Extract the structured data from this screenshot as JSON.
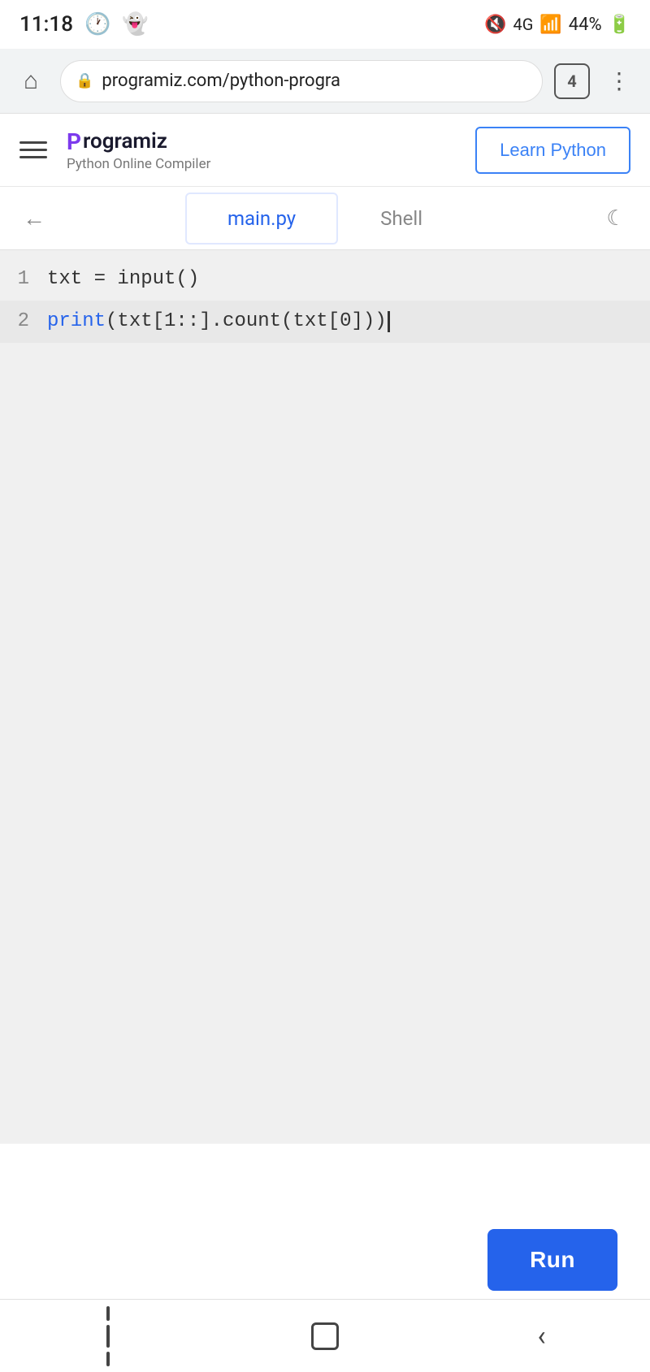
{
  "status_bar": {
    "time": "11:18",
    "battery": "44%"
  },
  "browser": {
    "url": "programiz.com/python-progra",
    "tab_count": "4"
  },
  "header": {
    "logo_name": "rogramiz",
    "subtitle": "Python Online Compiler",
    "learn_python_label": "Learn Python"
  },
  "tabs": {
    "main_py_label": "main.py",
    "shell_label": "Shell"
  },
  "code": {
    "line1": "txt = input()",
    "line2_keyword": "print",
    "line2_rest": "(txt[1::].count(txt[0]))"
  },
  "run_button": {
    "label": "Run"
  },
  "bottom_nav": {
    "back_label": "<"
  }
}
